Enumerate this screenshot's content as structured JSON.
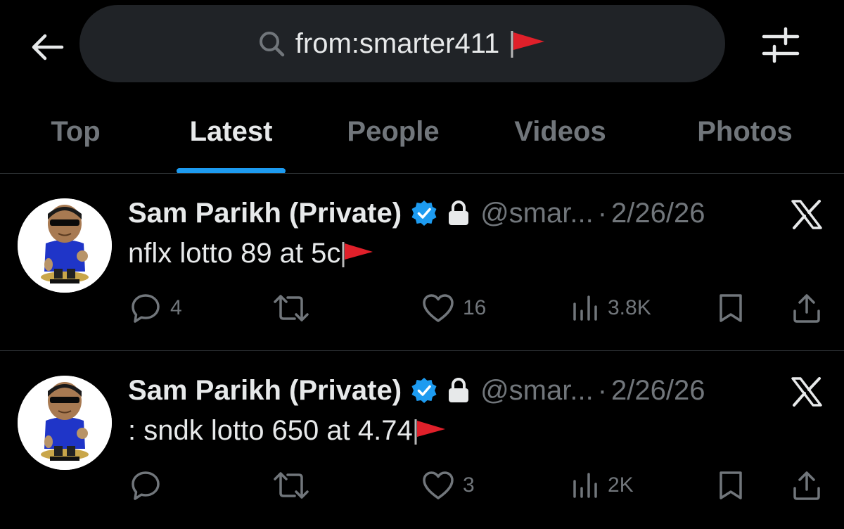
{
  "search": {
    "query": "from:smarter411"
  },
  "tabs": [
    {
      "label": "Top",
      "active": false
    },
    {
      "label": "Latest",
      "active": true
    },
    {
      "label": "People",
      "active": false
    },
    {
      "label": "Videos",
      "active": false
    },
    {
      "label": "Photos",
      "active": false
    }
  ],
  "tweets": [
    {
      "name": "Sam Parikh (Private)",
      "handle": "@smar...",
      "separator": "·",
      "date": "2/26/26",
      "text": "nflx lotto 89 at 5c",
      "replies": "4",
      "reposts": "",
      "likes": "16",
      "views": "3.8K"
    },
    {
      "name": "Sam Parikh (Private)",
      "handle": "@smar...",
      "separator": "·",
      "date": "2/26/26",
      "text": ": sndk lotto 650 at 4.74",
      "replies": "",
      "reposts": "",
      "likes": "3",
      "views": "2K"
    }
  ],
  "colors": {
    "background": "#000000",
    "accent": "#1d9bf0",
    "muted": "#71767b",
    "text": "#e7e9ea",
    "flag": "#e0202a"
  },
  "icons": [
    "back-arrow-icon",
    "search-icon",
    "red-flag-icon",
    "filter-sliders-icon",
    "verified-badge-icon",
    "lock-icon",
    "x-logo-icon",
    "reply-icon",
    "repost-icon",
    "like-icon",
    "views-icon",
    "bookmark-icon",
    "share-icon"
  ]
}
